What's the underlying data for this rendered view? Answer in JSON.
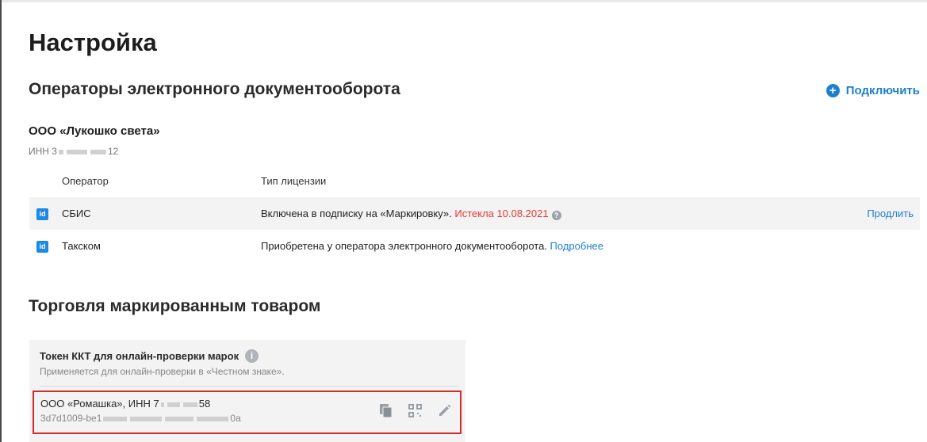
{
  "page": {
    "title": "Настройка"
  },
  "edo": {
    "section_title": "Операторы электронного документооборота",
    "connect_label": "Подключить",
    "company_name": "ООО «Лукошко света»",
    "inn_label": "ИНН 3",
    "inn_tail": "12",
    "columns": {
      "operator": "Оператор",
      "license": "Тип лицензии"
    },
    "rows": [
      {
        "icon": "id",
        "operator": "СБИС",
        "license_text": "Включена в подписку на «Маркировку».",
        "license_status": "Истекла 10.08.2021",
        "action": "Продлить"
      },
      {
        "icon": "id",
        "operator": "Такском",
        "license_text": "Приобретена у оператора электронного документооборота.",
        "license_link": "Подробнее"
      }
    ]
  },
  "marked": {
    "section_title": "Торговля маркированным товаром",
    "token_title": "Токен ККТ для онлайн-проверки марок",
    "token_subtitle": "Применяется для онлайн-проверки в «Честном знаке».",
    "entry": {
      "name_prefix": "ООО «Ромашка», ИНН 7",
      "name_tail": "58",
      "token_prefix": "3d7d1009-be1",
      "token_tail": "0a"
    }
  },
  "colors": {
    "accent": "#1f7fcf",
    "expired": "#e53935",
    "highlight_border": "#d52b2b"
  }
}
